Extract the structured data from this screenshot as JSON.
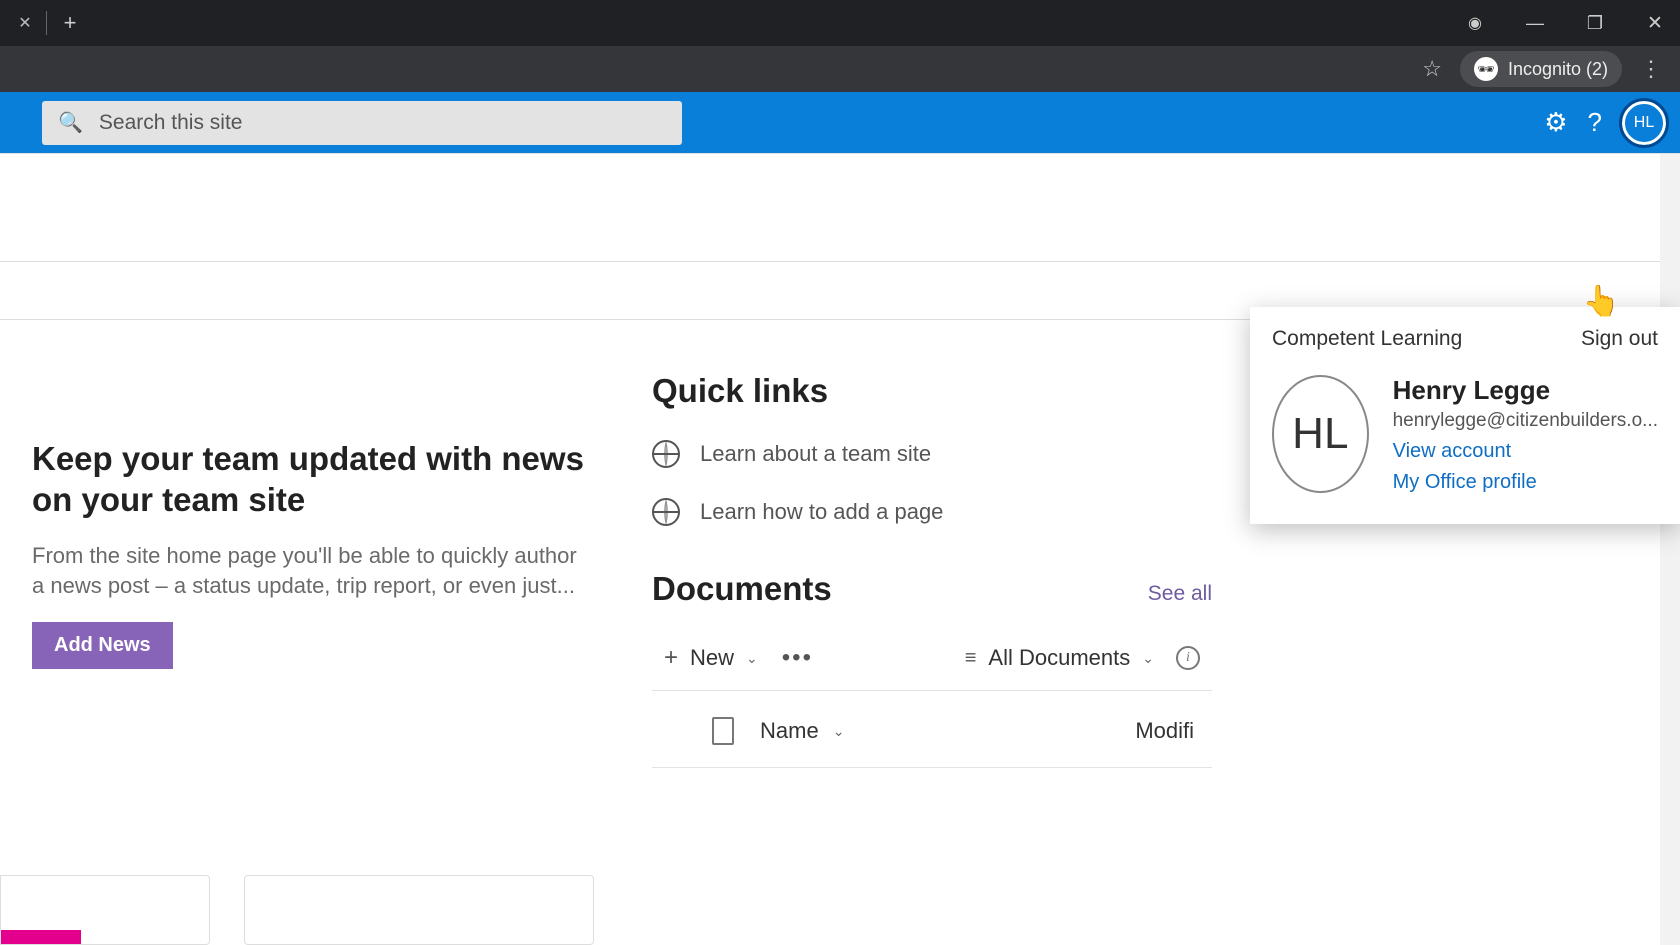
{
  "browser": {
    "incognito_label": "Incognito (2)"
  },
  "header": {
    "search_placeholder": "Search this site",
    "avatar_initials": "HL"
  },
  "flyout": {
    "org": "Competent Learning",
    "sign_out": "Sign out",
    "avatar_initials": "HL",
    "name": "Henry Legge",
    "email": "henrylegge@citizenbuilders.o...",
    "view_account": "View account",
    "office_profile": "My Office profile"
  },
  "news": {
    "title": "Keep your team updated with news on your team site",
    "desc": "From the site home page you'll be able to quickly author a news post – a status update, trip report, or even just...",
    "button": "Add News"
  },
  "quick_links": {
    "heading": "Quick links",
    "items": [
      {
        "label": "Learn about a team site"
      },
      {
        "label": "Learn how to add a page"
      }
    ]
  },
  "documents": {
    "heading": "Documents",
    "see_all": "See all",
    "new_label": "New",
    "view_label": "All Documents",
    "columns": {
      "name": "Name",
      "modified": "Modifi"
    }
  }
}
